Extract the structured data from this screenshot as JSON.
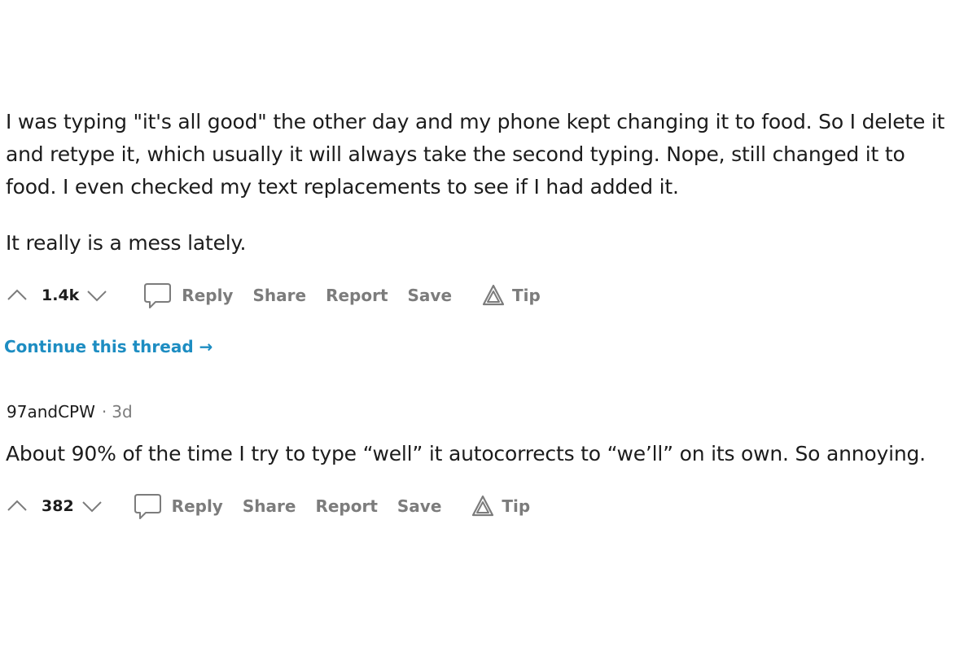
{
  "comment1": {
    "paragraph1_lines": [
      "I was typing \"it's all good\" the other day and my phone kept changing it to food. So I delete it",
      "and retype it, which usually it will always take the second typing. Nope, still changed it to",
      "food. I even checked my text replacements to see if I had added it."
    ],
    "paragraph2": "It really is a mess lately.",
    "actions": {
      "score": "1.4k",
      "reply": "Reply",
      "share": "Share",
      "report": "Report",
      "save": "Save",
      "tip": "Tip"
    }
  },
  "continue_thread": "Continue this thread →",
  "comment2": {
    "author": "97andCPW",
    "separator": "·",
    "age": "3d",
    "body": "About 90% of the time I try to type “well” it autocorrects to “we’ll” on its own. So annoying.",
    "actions": {
      "score": "382",
      "reply": "Reply",
      "share": "Share",
      "report": "Report",
      "save": "Save",
      "tip": "Tip"
    }
  },
  "colors": {
    "link": "#1d8dc2",
    "muted": "#7c7c7c",
    "text": "#1c1c1c"
  },
  "icons": [
    "upvote-icon",
    "downvote-icon",
    "comment-bubble-icon",
    "tip-triangle-icon"
  ]
}
